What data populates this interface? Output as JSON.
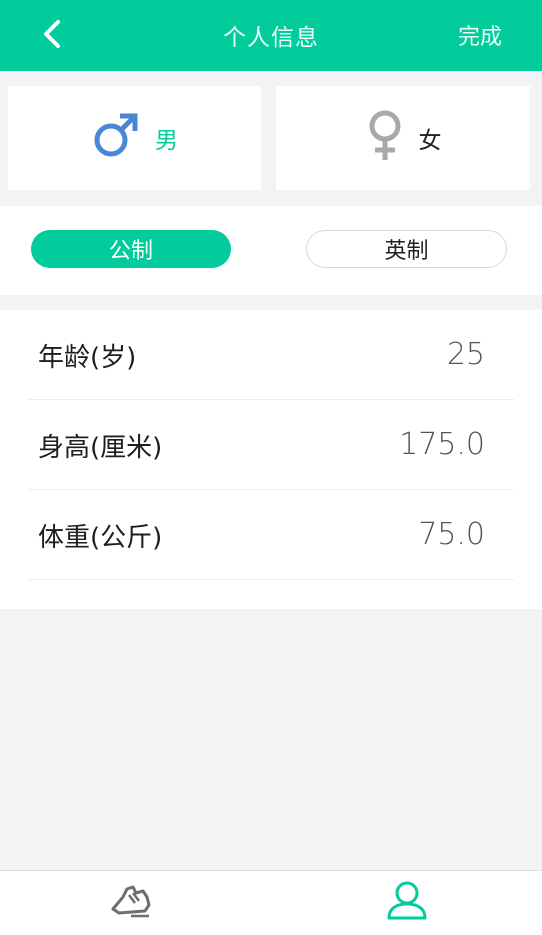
{
  "header": {
    "title": "个人信息",
    "done_label": "完成",
    "back_icon": "chevron-left-icon"
  },
  "gender": {
    "male_label": "男",
    "female_label": "女",
    "selected": "male",
    "male_color": "#4a86d8",
    "female_color": "#a9a9a9"
  },
  "units": {
    "metric_label": "公制",
    "imperial_label": "英制",
    "selected": "metric"
  },
  "profile": {
    "rows": [
      {
        "label": "年龄(岁)",
        "value": "25"
      },
      {
        "label": "身高(厘米)",
        "value": "175.0"
      },
      {
        "label": "体重(公斤)",
        "value": "75.0"
      }
    ]
  },
  "tabbar": {
    "tabs": [
      {
        "icon": "running-shoe-icon",
        "active": false
      },
      {
        "icon": "user-profile-icon",
        "active": true
      }
    ]
  },
  "colors": {
    "accent": "#02cc9b",
    "background": "#f3f3f5"
  }
}
